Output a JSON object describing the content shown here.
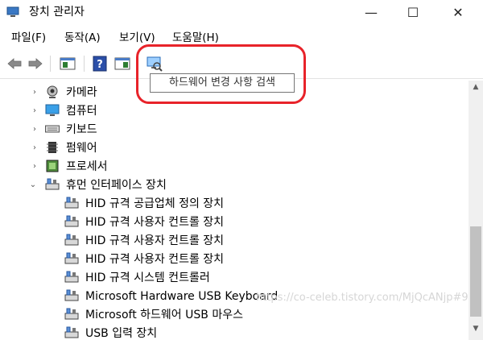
{
  "window": {
    "title": "장치 관리자",
    "minimize_glyph": "—",
    "maximize_glyph": "☐",
    "close_glyph": "✕"
  },
  "menu": [
    "파일(F)",
    "동작(A)",
    "보기(V)",
    "도움말(H)"
  ],
  "toolbar": {
    "buttons": [
      "back-icon",
      "forward-icon",
      "properties-panel-icon",
      "help-icon",
      "action-pane-icon",
      "scan-hardware-icon"
    ],
    "tooltip": "하드웨어 변경 사항 검색"
  },
  "tree": {
    "categories": [
      {
        "label": "카메라",
        "icon": "camera-icon",
        "expanded": false
      },
      {
        "label": "컴퓨터",
        "icon": "computer-icon",
        "expanded": false
      },
      {
        "label": "키보드",
        "icon": "keyboard-icon",
        "expanded": false
      },
      {
        "label": "펌웨어",
        "icon": "firmware-icon",
        "expanded": false
      },
      {
        "label": "프로세서",
        "icon": "processor-icon",
        "expanded": false
      },
      {
        "label": "휴먼 인터페이스 장치",
        "icon": "hid-icon",
        "expanded": true
      }
    ],
    "hid_children": [
      "HID 규격 공급업체 정의 장치",
      "HID 규격 사용자 컨트롤 장치",
      "HID 규격 사용자 컨트롤 장치",
      "HID 규격 사용자 컨트롤 장치",
      "HID 규격 시스템 컨트롤러",
      "Microsoft Hardware USB Keyboard",
      "Microsoft 하드웨어 USB 마우스",
      "USB 입력 장치"
    ]
  },
  "watermark": "https://co-celeb.tistory.com/MjQcANjp#9",
  "colors": {
    "highlight": "#e8232a",
    "scrollbar": "#f0f0f0",
    "thumb": "#c1c1c1"
  }
}
